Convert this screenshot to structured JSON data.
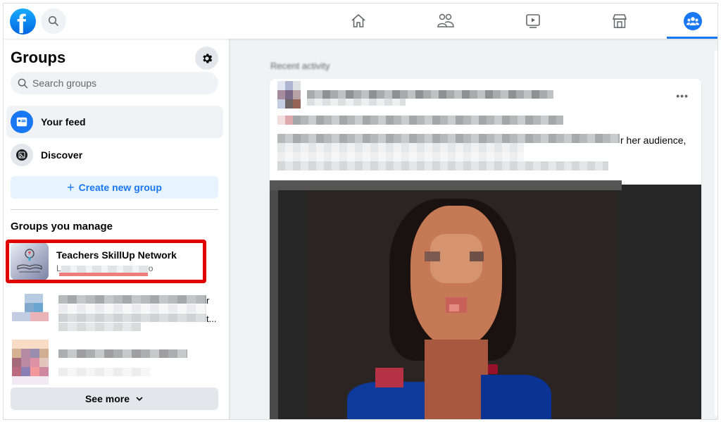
{
  "topbar": {
    "logo_letter": "f",
    "nav_tabs": [
      {
        "name": "home",
        "icon": "home-icon",
        "active": false
      },
      {
        "name": "friends",
        "icon": "friends-icon",
        "active": false
      },
      {
        "name": "watch",
        "icon": "watch-icon",
        "active": false
      },
      {
        "name": "marketplace",
        "icon": "marketplace-icon",
        "active": false
      },
      {
        "name": "groups",
        "icon": "groups-icon",
        "active": true
      }
    ],
    "accent_color": "#1877f2"
  },
  "sidebar": {
    "title": "Groups",
    "search_placeholder": "Search groups",
    "items": [
      {
        "label": "Your feed",
        "icon": "feed-icon",
        "active": true
      },
      {
        "label": "Discover",
        "icon": "discover-icon",
        "active": false
      }
    ],
    "create_button": {
      "icon": "+",
      "label": "Create new group"
    },
    "section_title": "Groups you manage",
    "groups": [
      {
        "name": "Teachers SkillUp Network",
        "subtitle_prefix": "L",
        "subtitle_suffix": "o",
        "highlighted": true
      },
      {
        "name": "",
        "subtitle": "",
        "trailing_text_1": "r",
        "trailing_text_2": "t..."
      },
      {
        "name": "",
        "subtitle": ""
      }
    ],
    "see_more": "See more",
    "highlight_color": "#e00000"
  },
  "main": {
    "section_heading": "Recent activity",
    "post": {
      "more_label": "•••",
      "visible_text": "r her audience,"
    }
  }
}
